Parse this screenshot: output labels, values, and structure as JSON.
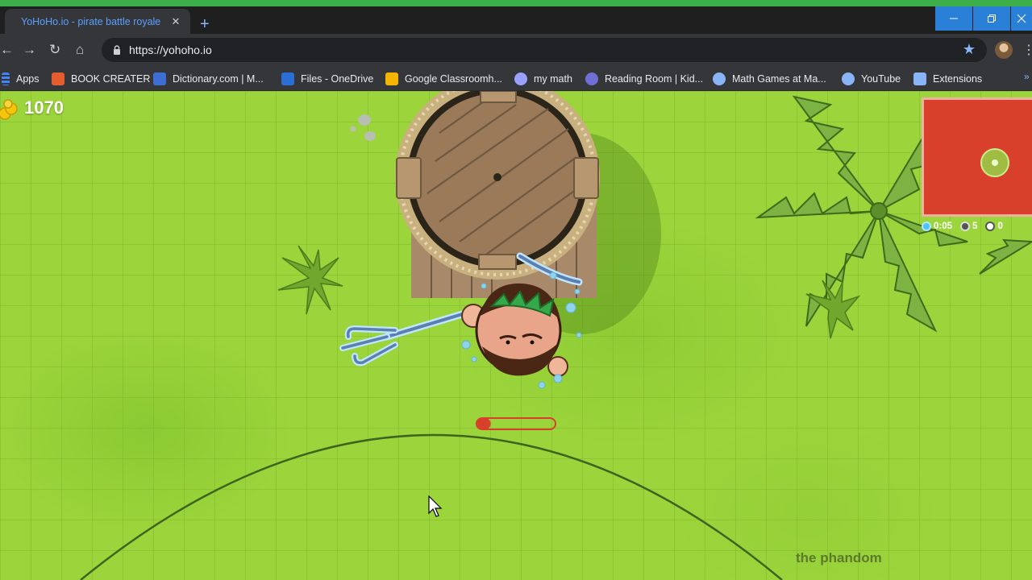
{
  "browser": {
    "tab_title": "YoHoHo.io - pirate battle royale",
    "tab_close": "✕",
    "new_tab": "+",
    "url": "https://yohoho.io",
    "bookmarks": [
      {
        "label": "Apps",
        "icon": "apps-grid-icon",
        "color": "#4285f4"
      },
      {
        "label": "BOOK CREATER",
        "icon": "book-creator-icon",
        "color": "#e35d2f"
      },
      {
        "label": "Dictionary.com | M...",
        "icon": "dictionary-icon",
        "color": "#3c6fd1"
      },
      {
        "label": "Files - OneDrive",
        "icon": "onedrive-cloud-icon",
        "color": "#2b6fd6"
      },
      {
        "label": "Google Classroomh...",
        "icon": "classroom-icon",
        "color": "#f4b400"
      },
      {
        "label": "my math",
        "icon": "my-math-icon",
        "color": "#9aa0ff"
      },
      {
        "label": "Reading Room | Kid...",
        "icon": "reading-room-icon",
        "color": "#6f6fd6"
      },
      {
        "label": "Math Games at Ma...",
        "icon": "globe-icon",
        "color": "#8ab4f8"
      },
      {
        "label": "YouTube",
        "icon": "globe-icon",
        "color": "#8ab4f8"
      },
      {
        "label": "Extensions",
        "icon": "puzzle-icon",
        "color": "#8ab4f8"
      }
    ]
  },
  "game": {
    "score": "1070",
    "minimap_color": "#d9402b",
    "stats": {
      "timer": "0:05",
      "players": "5",
      "kills": "0"
    },
    "player_name": "the phandom",
    "health_bar_fraction": 0.18
  }
}
